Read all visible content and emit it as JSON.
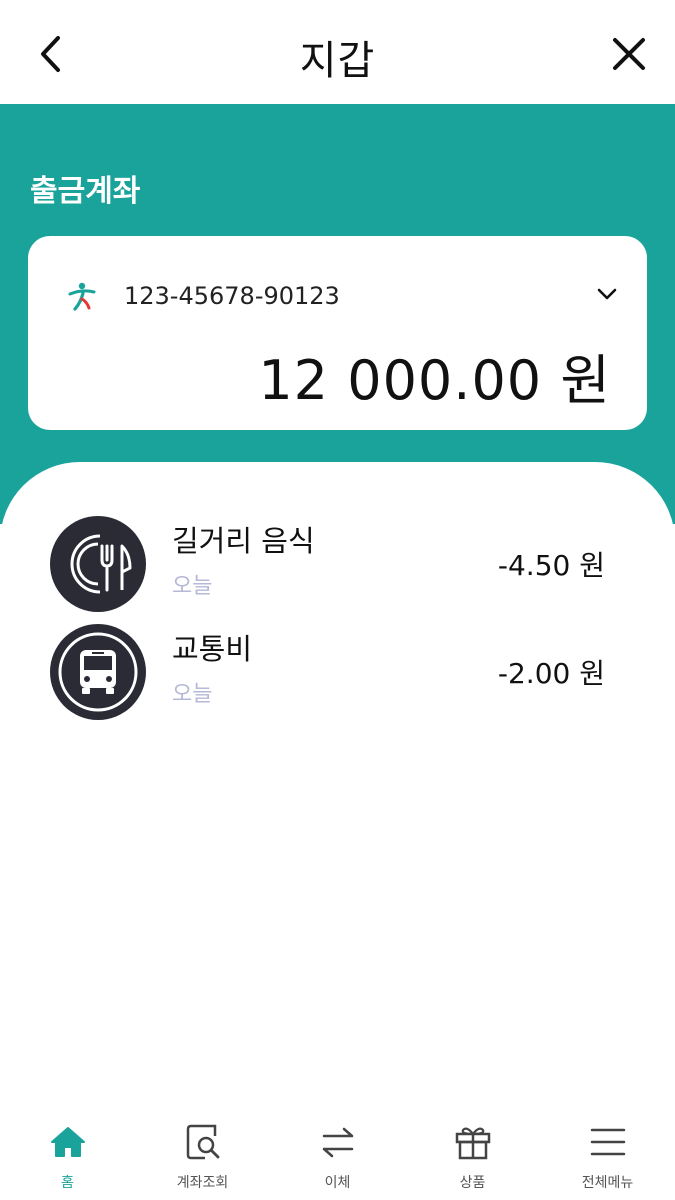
{
  "header": {
    "title": "지갑",
    "back_icon": "chevron-left-icon",
    "close_icon": "close-icon"
  },
  "account": {
    "section_label": "출금계좌",
    "number": "123-45678-90123",
    "balance": "12 000.00 원",
    "bank_icon": "bank-logo-icon",
    "dropdown_icon": "chevron-down-icon"
  },
  "transactions": [
    {
      "title": "길거리 음식",
      "date": "오늘",
      "amount": "-4.50 원",
      "icon": "plate-cutlery-icon"
    },
    {
      "title": "교통비",
      "date": "오늘",
      "amount": "-2.00 원",
      "icon": "bus-icon"
    }
  ],
  "nav": {
    "items": [
      {
        "label": "홈",
        "icon": "home-icon",
        "active": true
      },
      {
        "label": "계좌조회",
        "icon": "account-search-icon",
        "active": false
      },
      {
        "label": "이체",
        "icon": "transfer-icon",
        "active": false
      },
      {
        "label": "상품",
        "icon": "gift-icon",
        "active": false
      },
      {
        "label": "전체메뉴",
        "icon": "menu-icon",
        "active": false
      }
    ]
  },
  "colors": {
    "brand": "#1aa39a",
    "icon_bg": "#2a2b35",
    "muted": "#b5b9d6"
  }
}
